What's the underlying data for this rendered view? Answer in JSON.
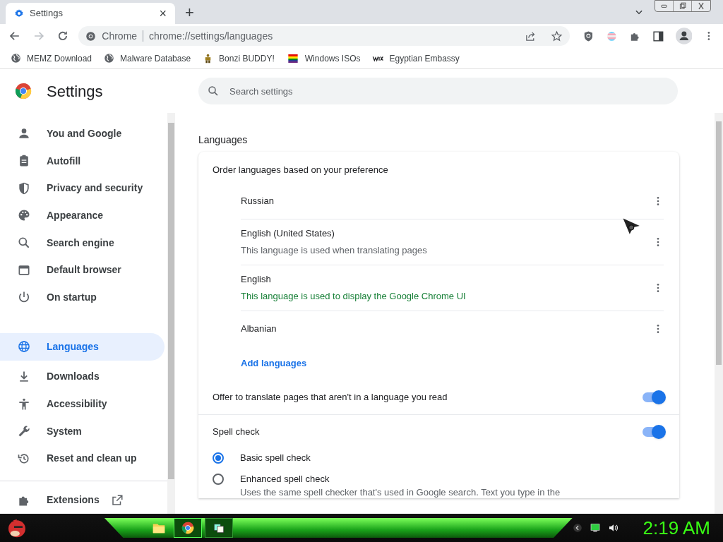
{
  "tab": {
    "title": "Settings",
    "close": "×",
    "new_tab": "+"
  },
  "omnibox": {
    "site": "Chrome",
    "url": "chrome://settings/languages"
  },
  "bookmarks": [
    {
      "label": "MEMZ Download",
      "kind": "globe"
    },
    {
      "label": "Malware Database",
      "kind": "globe"
    },
    {
      "label": "Bonzi BUDDY!",
      "kind": "figure"
    },
    {
      "label": "Windows ISOs",
      "kind": "rainbow"
    },
    {
      "label": "Egyptian Embassy",
      "kind": "wix"
    }
  ],
  "header": {
    "title": "Settings",
    "search_placeholder": "Search settings"
  },
  "sidebar": {
    "items": [
      {
        "label": "You and Google",
        "selected": false
      },
      {
        "label": "Autofill",
        "selected": false
      },
      {
        "label": "Privacy and security",
        "selected": false
      },
      {
        "label": "Appearance",
        "selected": false
      },
      {
        "label": "Search engine",
        "selected": false
      },
      {
        "label": "Default browser",
        "selected": false
      },
      {
        "label": "On startup",
        "selected": false
      },
      {
        "label": "Languages",
        "selected": true
      },
      {
        "label": "Downloads",
        "selected": false
      },
      {
        "label": "Accessibility",
        "selected": false
      },
      {
        "label": "System",
        "selected": false
      },
      {
        "label": "Reset and clean up",
        "selected": false
      }
    ],
    "extensions": "Extensions"
  },
  "section_title": "Languages",
  "card": {
    "order_label": "Order languages based on your preference",
    "languages": [
      {
        "name": "Russian"
      },
      {
        "name": "English (United States)",
        "note": "This language is used when translating pages",
        "kind": "plain"
      },
      {
        "name": "English",
        "note": "This language is used to display the Google Chrome UI",
        "kind": "accent"
      },
      {
        "name": "Albanian"
      }
    ],
    "add_languages": "Add languages",
    "toggles": [
      {
        "label": "Offer to translate pages that aren't in a language you read",
        "on": true
      },
      {
        "label": "Spell check",
        "on": true
      }
    ],
    "spell_options": [
      {
        "label": "Basic spell check",
        "selected": true
      },
      {
        "label": "Enhanced spell check",
        "description": "Uses the same spell checker that's used in Google search. Text you type in the",
        "selected": false
      }
    ]
  },
  "taskbar": {
    "clock": "2:19 AM"
  }
}
